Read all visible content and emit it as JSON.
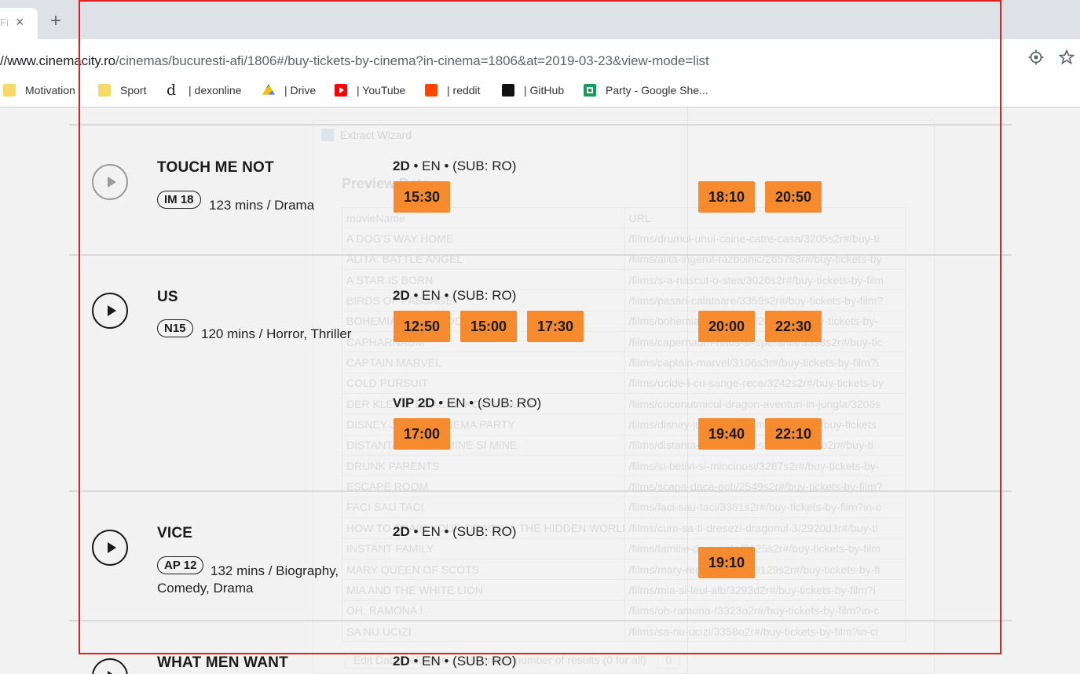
{
  "browser": {
    "tab": {
      "title": "Fi"
    },
    "new_tab_label": "+",
    "close_glyph": "×",
    "url_host": "//www.cinemacity.ro",
    "url_path": "/cinemas/bucuresti-afi/1806#/buy-tickets-by-cinema?in-cinema=1806&at=2019-03-23&view-mode=list",
    "bookmarks": [
      {
        "label": "Motivation",
        "icon": "folder-icon"
      },
      {
        "label": "Sport",
        "icon": "folder-icon"
      },
      {
        "label": "| dexonline",
        "icon": "dexonline-icon"
      },
      {
        "label": "| Drive",
        "icon": "drive-icon"
      },
      {
        "label": "| YouTube",
        "icon": "youtube-icon"
      },
      {
        "label": "| reddit",
        "icon": "reddit-icon"
      },
      {
        "label": "| GitHub",
        "icon": "github-icon"
      },
      {
        "label": "Party - Google She...",
        "icon": "sheets-icon"
      }
    ]
  },
  "wizard": {
    "title": "Extract Wizard",
    "heading": "Preview Data",
    "columns": [
      "movieName",
      "URL"
    ],
    "rows": [
      [
        "A DOG'S WAY HOME",
        "/films/drumul-unui-caine-catre-casa/3205s2r#/buy-ti"
      ],
      [
        "ALITA: BATTLE ANGEL",
        "/films/alita-ingerul-razboinic/2657s3r#/buy-tickets-by"
      ],
      [
        "A STAR IS BORN",
        "/films/s-a-nascut-o-stea/3026s2r#/buy-tickets-by-film"
      ],
      [
        "BIRDS OF PASSAGE",
        "/films/pasari-calatoare/3359s2r#/buy-tickets-by-film?"
      ],
      [
        "BOHEMIAN RHAPSODY",
        "/films/bohemian-rhapsody/2888s2r#/buy-tickets-by-"
      ],
      [
        "CAPHARNAUM",
        "/films/capernaum-haos-si-speranta/3338s2r#/buy-tic"
      ],
      [
        "CAPTAIN MARVEL",
        "/films/captain-marvel/3106s3r#/buy-tickets-by-film?i"
      ],
      [
        "COLD PURSUIT",
        "/films/ucide-i-cu-sange-rece/3242s2r#/buy-tickets-by"
      ],
      [
        "DER KLEINE DRACHE KOKOSNUSS",
        "/films/coconutmicul-dragon-aventuri-in-jungla/3206s"
      ],
      [
        "DISNEY JUNIOR CINEMA PARTY",
        "/films/disney-junior-in-cinema/3419d2r#/buy-tickets"
      ],
      [
        "DISTANTA DINTRE MINE SI MINE",
        "/films/distanta-dintre-mine-si-mine/3384o2r#/buy-ti"
      ],
      [
        "DRUNK PARENTS",
        "/films/si-betivi-si-mincinosi/3287s2r#/buy-tickets-by-"
      ],
      [
        "ESCAPE ROOM",
        "/films/scapa-daca-poti/2549s2r#/buy-tickets-by-film?"
      ],
      [
        "FACI SAU TACI",
        "/films/faci-sau-taci/3361s2r#/buy-tickets-by-film?in-c"
      ],
      [
        "HOW TO TRAIN YOUR DRAGON: THE HIDDEN WORLD",
        "/films/cum-sa-ti-dresezi-dragonul-3/2920d3r#/buy-ti"
      ],
      [
        "INSTANT FAMILY",
        "/films/familie-de-a-gata/3125s2r#/buy-tickets-by-film"
      ],
      [
        "MARY QUEEN OF SCOTS",
        "/films/mary-regina-scotiei/3129s2r#/buy-tickets-by-fi"
      ],
      [
        "MIA AND THE WHITE LION",
        "/films/mia-si-leul-alb/3293d2r#/buy-tickets-by-film?i"
      ],
      [
        "OH, RAMONA !",
        "/films/oh-ramona-/3323o2r#/buy-tickets-by-film?in-c"
      ],
      [
        "SA NU UCIZI",
        "/films/sa-nu-ucizi/3358o2r#/buy-tickets-by-film?in-ci"
      ]
    ],
    "bottom_button": "Edit Data Definition",
    "max_label": "Maximum number of results (0 for all)",
    "max_value": "0"
  },
  "movies": [
    {
      "title": "TOUCH ME NOT",
      "rating": "IM 18",
      "meta": "123 mins / Drama",
      "formats": [
        {
          "kind": "2D",
          "lang": " • EN • (SUB:  RO)",
          "times": [
            "15:30",
            "18:10",
            "20:50"
          ]
        }
      ]
    },
    {
      "title": "US",
      "rating": "N15",
      "meta": "120 mins / Horror, Thriller",
      "formats": [
        {
          "kind": "2D",
          "lang": " • EN • (SUB:  RO)",
          "times": [
            "12:50",
            "15:00",
            "17:30",
            "20:00",
            "22:30"
          ]
        },
        {
          "kind": "VIP 2D",
          "lang": " • EN • (SUB:  RO)",
          "times": [
            "17:00",
            "19:40",
            "22:10"
          ]
        }
      ]
    },
    {
      "title": "VICE",
      "rating": "AP 12",
      "meta": "132 mins / Biography,",
      "meta2": "Comedy, Drama",
      "formats": [
        {
          "kind": "2D",
          "lang": " • EN • (SUB:  RO)",
          "times": [
            "19:10"
          ]
        }
      ]
    },
    {
      "title": "WHAT MEN WANT",
      "formats": [
        {
          "kind": "2D",
          "lang": " • EN • (SUB:  RO)"
        }
      ]
    }
  ]
}
